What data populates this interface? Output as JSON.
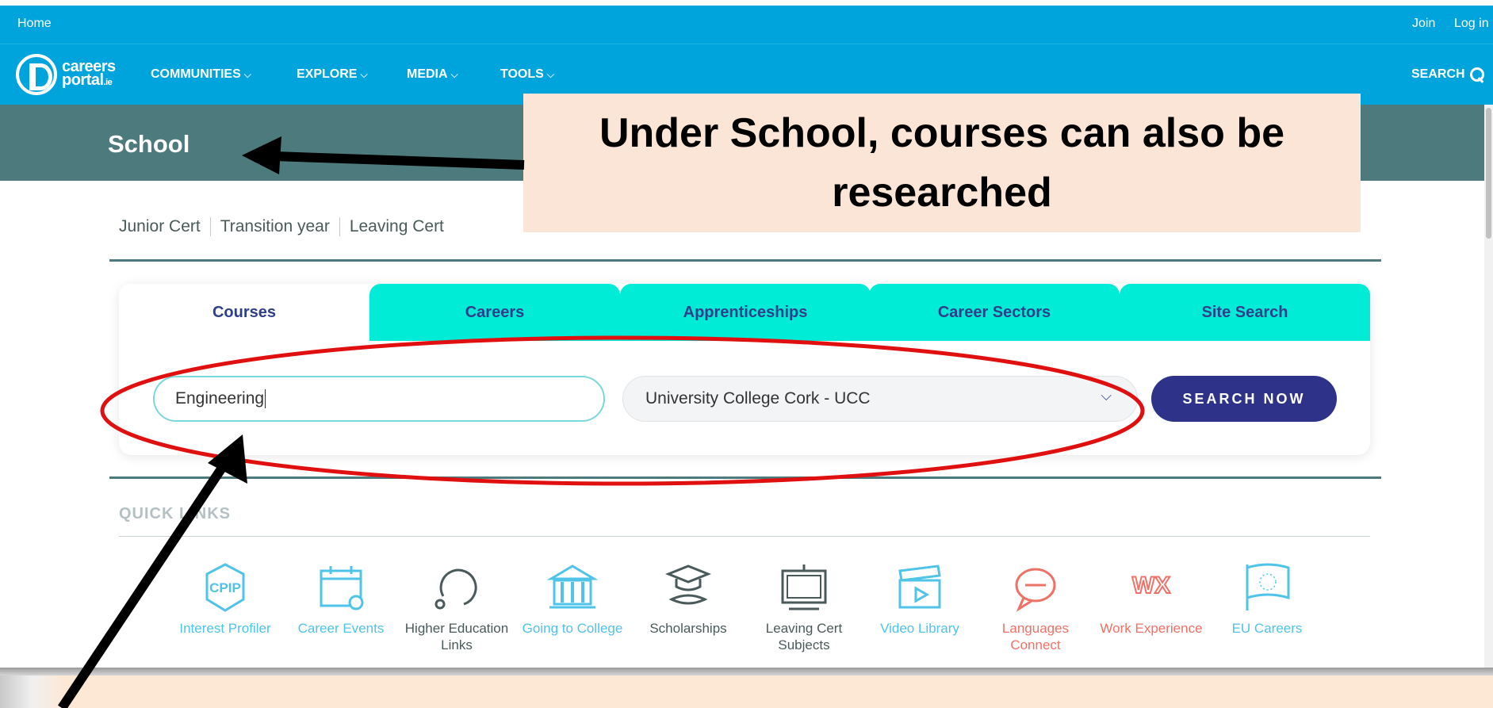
{
  "topbar": {
    "home": "Home",
    "join": "Join",
    "login": "Log in"
  },
  "nav": {
    "logo_line1": "careers",
    "logo_line2": "portal",
    "logo_suffix": ".ie",
    "menu": [
      "COMMUNITIES",
      "EXPLORE",
      "MEDIA",
      "TOOLS"
    ],
    "search_label": "SEARCH"
  },
  "band": {
    "title": "School"
  },
  "sublinks": [
    "Junior Cert",
    "Transition year",
    "Leaving Cert"
  ],
  "tabs": [
    {
      "label": "Courses",
      "active": true
    },
    {
      "label": "Careers",
      "active": false
    },
    {
      "label": "Apprenticeships",
      "active": false
    },
    {
      "label": "Career Sectors",
      "active": false
    },
    {
      "label": "Site Search",
      "active": false
    }
  ],
  "search": {
    "query_value": "Engineering",
    "college_selected": "University College Cork - UCC",
    "button_label": "SEARCH NOW"
  },
  "quick_links": {
    "title": "QUICK LINKS",
    "items": [
      {
        "label": "Interest Profiler",
        "icon": "cpip-badge-icon",
        "color": "#4fc3e8"
      },
      {
        "label": "Career Events",
        "icon": "calendar-icon",
        "color": "#4fc3e8"
      },
      {
        "label": "Higher Education Links",
        "icon": "loop-icon",
        "color": "#4a5a5a"
      },
      {
        "label": "Going to College",
        "icon": "college-building-icon",
        "color": "#4fc3e8"
      },
      {
        "label": "Scholarships",
        "icon": "graduation-cap-icon",
        "color": "#4a5a5a"
      },
      {
        "label": "Leaving Cert Subjects",
        "icon": "subjects-board-icon",
        "color": "#4a5a5a"
      },
      {
        "label": "Video Library",
        "icon": "clapperboard-icon",
        "color": "#4fc3e8"
      },
      {
        "label": "Languages Connect",
        "icon": "speech-bubbles-icon",
        "color": "#f07167"
      },
      {
        "label": "Work Experience",
        "icon": "wx-logo-icon",
        "color": "#f07167"
      },
      {
        "label": "EU Careers",
        "icon": "eu-flag-icon",
        "color": "#4fc3e8"
      }
    ]
  },
  "callout": {
    "text": "Under School, courses can also be researched"
  },
  "colors": {
    "brand_blue": "#00a4dc",
    "band_teal": "#4d7a7c",
    "tab_cyan": "#00ecd6",
    "button_navy": "#2e3288",
    "annotation_red": "#e01010"
  }
}
